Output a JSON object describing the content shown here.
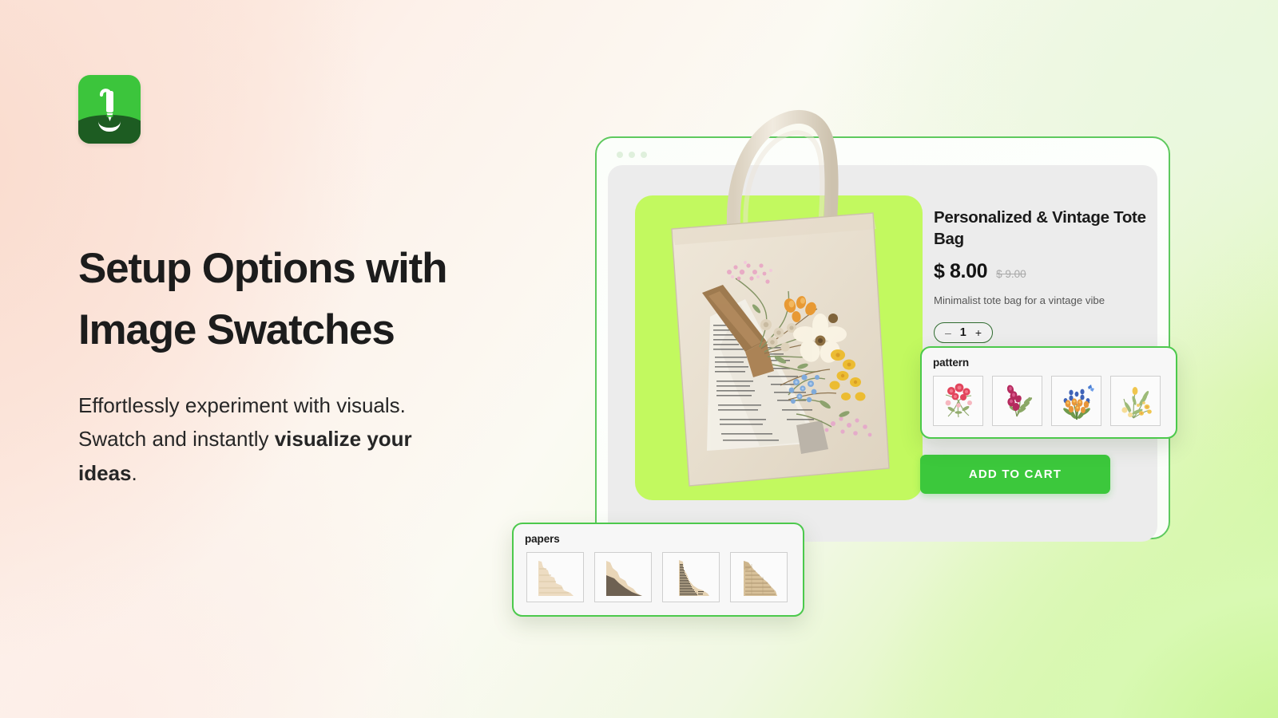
{
  "brand": {
    "logo_icon": "pen-stylus-logo-icon"
  },
  "hero": {
    "heading": "Setup Options with Image Swatches",
    "subtext_1": "Effortlessly experiment with visuals. Swatch and instantly ",
    "subtext_bold": "visualize your ideas",
    "subtext_2": "."
  },
  "browser": {
    "dot_1": "window-dot",
    "dot_2": "window-dot",
    "dot_3": "window-dot"
  },
  "product": {
    "image_alt": "personalized vintage tote bag with pressed flowers and newspaper print",
    "image_bg_color": "#c2f95f",
    "title": "Personalized & Vintage Tote Bag",
    "price": "$ 8.00",
    "old_price": "$ 9.00",
    "description": "Minimalist tote bag for a vintage vibe",
    "quantity": {
      "minus": "–",
      "value": "1",
      "plus": "+"
    },
    "add_to_cart": "ADD TO CART"
  },
  "panels": {
    "pattern": {
      "title": "pattern",
      "swatches": [
        {
          "name": "red-carnation-floral-swatch"
        },
        {
          "name": "magenta-snapdragon-floral-swatch"
        },
        {
          "name": "blue-orange-wildflower-bouquet-swatch"
        },
        {
          "name": "yellow-wildflower-sprig-swatch"
        }
      ]
    },
    "papers": {
      "title": "papers",
      "swatches": [
        {
          "name": "plain-torn-paper-swatch"
        },
        {
          "name": "dark-brown-torn-paper-swatch"
        },
        {
          "name": "newsprint-torn-paper-swatch"
        },
        {
          "name": "aged-manuscript-torn-paper-swatch"
        }
      ]
    }
  },
  "colors": {
    "brand_green": "#3cc53c",
    "accent_lime": "#c2f95f",
    "border_green": "#4cc94c",
    "heading": "#1c1c1c"
  }
}
